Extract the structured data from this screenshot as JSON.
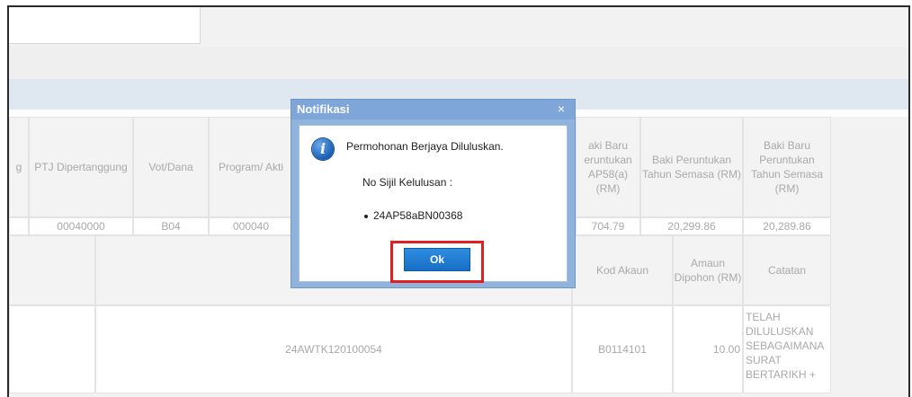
{
  "table": {
    "headers": [
      {
        "label": "g"
      },
      {
        "label": "PTJ Dipertanggung"
      },
      {
        "label": "Vot/Dana"
      },
      {
        "label": "Program/ Akti"
      },
      {
        "label": "aki Baru eruntukan AP58(a) (RM)"
      },
      {
        "label": "Baki Peruntukan Tahun Semasa (RM)"
      },
      {
        "label": "Baki Baru Peruntukan Tahun Semasa (RM)"
      }
    ],
    "row1": {
      "ptj": "00040000",
      "vot": "B04",
      "program": "000040",
      "baki_baru": "704.79",
      "baki_tahun": "20,299.86",
      "baki_baru_tahun": "20,289.86"
    },
    "header2": {
      "kod_akaun": "Kod Akaun",
      "amaun": "Amaun Dipohon (RM)",
      "catatan": "Catatan"
    },
    "row2": {
      "ref": "24AWTK120100054",
      "kod": "B0114101",
      "amaun": "10.00",
      "catatan": "TELAH DILULUSKAN SEBAGAIMANA SURAT BERTARIKH +"
    }
  },
  "dialog": {
    "title": "Notifikasi",
    "close": "×",
    "message": "Permohonan Berjaya Diluluskan.",
    "serial_label": "No Sijil Kelulusan :",
    "serial": "24AP58aBN00368",
    "ok": "Ok",
    "icon": "info-icon"
  },
  "colors": {
    "accent": "#1a72c9",
    "highlight": "#e02020",
    "dialog_border": "#8fb3dc"
  }
}
